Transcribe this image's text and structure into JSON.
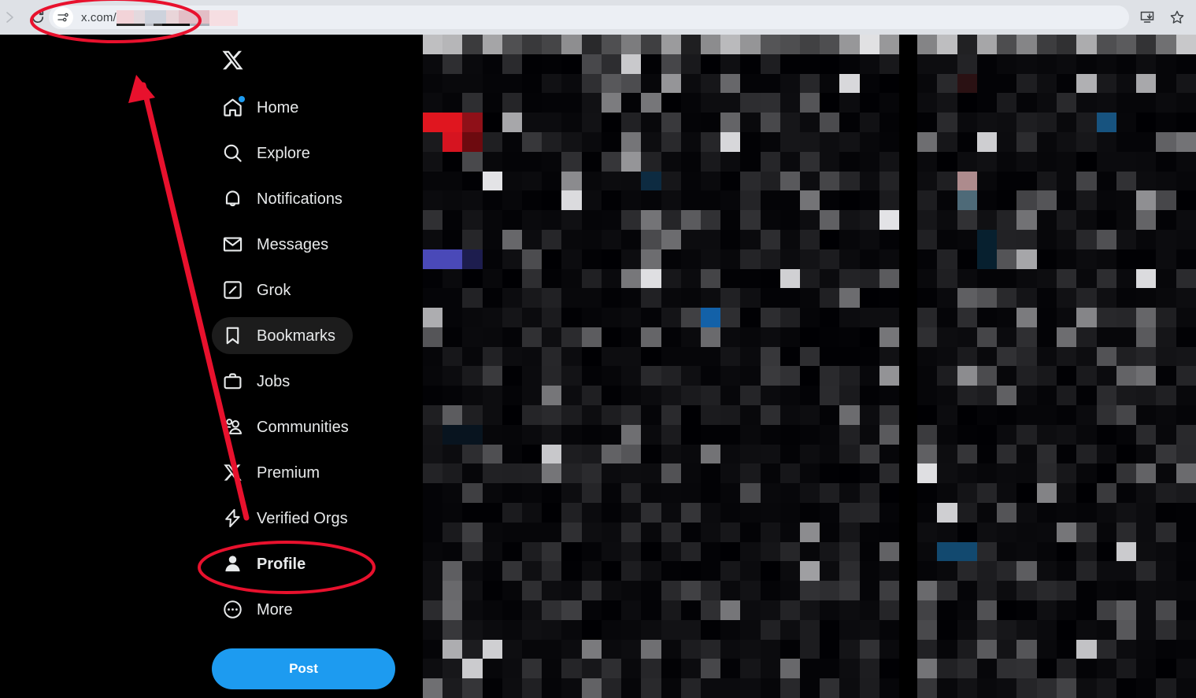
{
  "browser": {
    "back_icon": "back-arrow-icon",
    "forward_icon": "forward-arrow-icon",
    "reload_icon": "reload-icon",
    "site_settings_icon": "site-settings-sliders-icon",
    "url_domain": "x.com/",
    "url_redacted": true,
    "install_app_icon": "install-app-icon",
    "bookmark_icon": "bookmark-star-icon",
    "toolbar_bg": "#dee1e6",
    "omnibox_bg": "#eceff4"
  },
  "sidebar": {
    "logo_label": "X",
    "items": [
      {
        "label": "Home",
        "icon": "home-icon",
        "badge": true,
        "active": false,
        "bold": false
      },
      {
        "label": "Explore",
        "icon": "search-icon",
        "badge": false,
        "active": false,
        "bold": false
      },
      {
        "label": "Notifications",
        "icon": "bell-icon",
        "badge": false,
        "active": false,
        "bold": false
      },
      {
        "label": "Messages",
        "icon": "envelope-icon",
        "badge": false,
        "active": false,
        "bold": false
      },
      {
        "label": "Grok",
        "icon": "grok-icon",
        "badge": false,
        "active": false,
        "bold": false
      },
      {
        "label": "Bookmarks",
        "icon": "bookmark-icon",
        "badge": false,
        "active": true,
        "bold": false
      },
      {
        "label": "Jobs",
        "icon": "briefcase-icon",
        "badge": false,
        "active": false,
        "bold": false
      },
      {
        "label": "Communities",
        "icon": "communities-icon",
        "badge": false,
        "active": false,
        "bold": false
      },
      {
        "label": "Premium",
        "icon": "x-logo-icon",
        "badge": false,
        "active": false,
        "bold": false
      },
      {
        "label": "Verified Orgs",
        "icon": "lightning-icon",
        "badge": false,
        "active": false,
        "bold": false
      },
      {
        "label": "Profile",
        "icon": "person-icon",
        "badge": false,
        "active": false,
        "bold": true
      },
      {
        "label": "More",
        "icon": "more-circle-icon",
        "badge": false,
        "active": false,
        "bold": false
      }
    ],
    "post_button_label": "Post",
    "post_button_color": "#1d9bf0",
    "badge_color": "#1d9bf0",
    "active_pill_color": "#1c1c1c",
    "text_color": "#e7e9ea"
  },
  "content": {
    "censored": true,
    "description": "timeline and right sidebar are pixelated / redacted",
    "background": "#000000"
  },
  "annotations": {
    "color": "#e8112d",
    "shapes": [
      {
        "name": "url-bar-highlight-ellipse",
        "type": "ellipse"
      },
      {
        "name": "profile-highlight-ellipse",
        "type": "ellipse"
      },
      {
        "name": "pointer-arrow",
        "type": "arrow"
      }
    ]
  }
}
